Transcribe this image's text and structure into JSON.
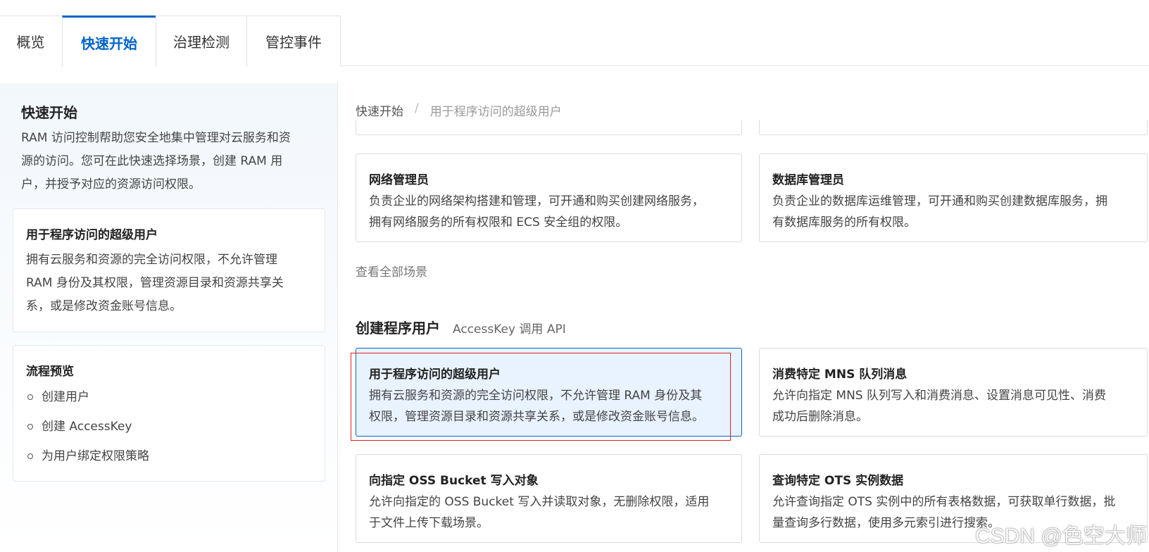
{
  "tabs": [
    {
      "label": "概览"
    },
    {
      "label": "快速开始"
    },
    {
      "label": "治理检测"
    },
    {
      "label": "管控事件"
    }
  ],
  "left": {
    "title": "快速开始",
    "desc_lines": [
      "RAM 访问控制帮助您安全地集中管理对云服务和资",
      "源的访问。您可在此快速选择场景，创建 RAM 用",
      "户，并授予对应的资源访问权限。"
    ],
    "scenario_card": {
      "title": "用于程序访问的超级用户",
      "desc_lines": [
        "拥有云服务和资源的完全访问权限，不允许管理",
        "RAM 身份及其权限，管理资源目录和资源共享关",
        "系，或是修改资金账号信息。"
      ]
    },
    "flow_card": {
      "title": "流程预览",
      "steps": [
        "创建用户",
        "创建 AccessKey",
        "为用户绑定权限策略"
      ]
    }
  },
  "breadcrumb": {
    "root": "快速开始",
    "separator": "/",
    "current": "用于程序访问的超级用户"
  },
  "cards_top": [
    {
      "title": "网络管理员",
      "lines": [
        "负责企业的网络架构搭建和管理，可开通和购买创建网络服务，",
        "拥有网络服务的所有权限和 ECS 安全组的权限。"
      ]
    },
    {
      "title": "数据库管理员",
      "lines": [
        "负责企业的数据库运维管理，可开通和购买创建数据库服务，拥",
        "有数据库服务的所有权限。"
      ]
    }
  ],
  "view_all": "查看全部场景",
  "section": {
    "title": "创建程序用户",
    "subtitle": "AccessKey 调用 API"
  },
  "cards_program": [
    {
      "title": "用于程序访问的超级用户",
      "lines": [
        "拥有云服务和资源的完全访问权限，不允许管理 RAM 身份及其",
        "权限，管理资源目录和资源共享关系，或是修改资金账号信息。"
      ],
      "selected": true
    },
    {
      "title": "消费特定 MNS 队列消息",
      "lines": [
        "允许向指定 MNS 队列写入和消费消息、设置消息可见性、消费",
        "成功后删除消息。"
      ]
    },
    {
      "title": "向指定 OSS Bucket 写入对象",
      "lines": [
        "允许向指定的 OSS Bucket 写入并读取对象，无删除权限，适用",
        "于文件上传下载场景。"
      ]
    },
    {
      "title": "查询特定 OTS 实例数据",
      "lines": [
        "允许查询指定 OTS 实例中的所有表格数据，可获取单行数据，批",
        "量查询多行数据，使用多元索引进行搜索。"
      ]
    }
  ],
  "watermark": "CSDN @色空大师",
  "colors": {
    "accent": "#0064c8",
    "selected_bg": "#e8f3ff",
    "highlight_box": "#e02020"
  }
}
